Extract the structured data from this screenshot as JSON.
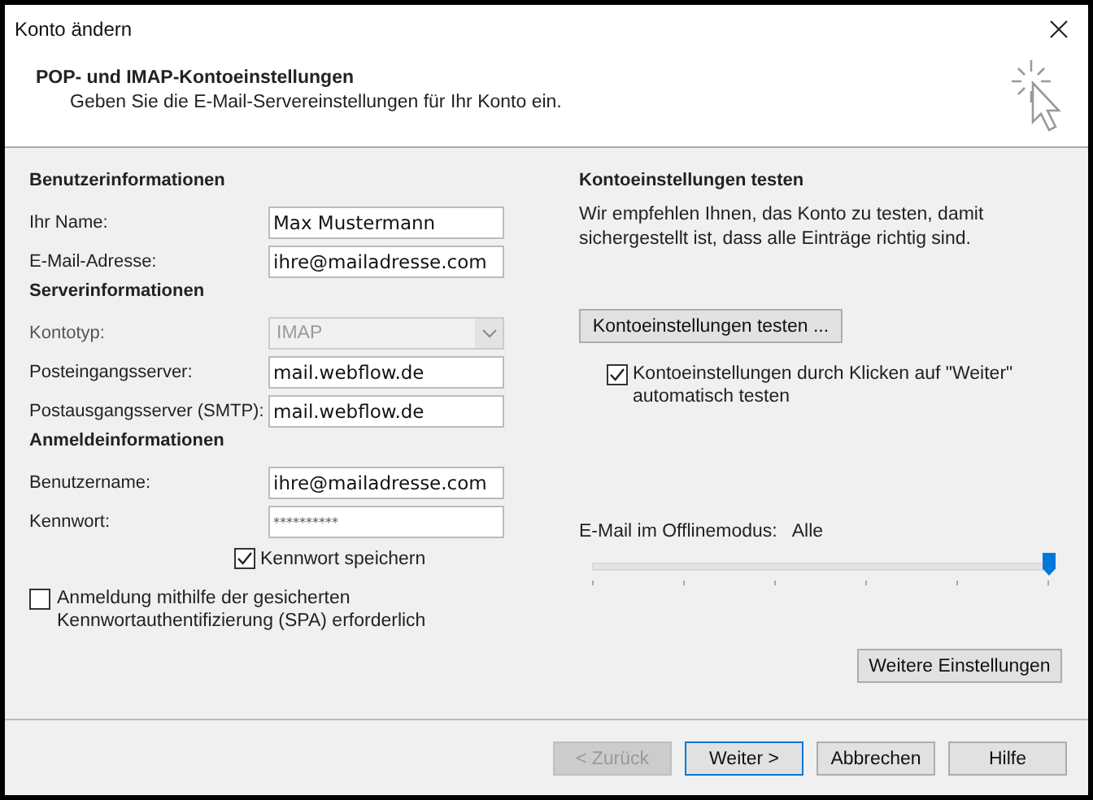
{
  "window": {
    "title": "Konto ändern"
  },
  "header": {
    "title": "POP- und IMAP-Kontoeinstellungen",
    "subtitle": "Geben Sie die E-Mail-Servereinstellungen für Ihr Konto ein."
  },
  "groups": [
    {
      "heading": "Benutzerinformationen",
      "fields": [
        {
          "label": "Ihr Name:",
          "value": "Max Mustermann",
          "kind": "text",
          "disabled": false
        },
        {
          "label": "E-Mail-Adresse:",
          "value": "ihre@mailadresse.com",
          "kind": "text",
          "disabled": false
        }
      ]
    },
    {
      "heading": "Serverinformationen",
      "fields": [
        {
          "label": "Kontotyp:",
          "value": "IMAP",
          "kind": "select",
          "disabled": true
        },
        {
          "label": "Posteingangsserver:",
          "value": "mail.webflow.de",
          "kind": "text",
          "disabled": false
        },
        {
          "label": "Postausgangsserver (SMTP):",
          "value": "mail.webflow.de",
          "kind": "text",
          "disabled": false
        }
      ]
    },
    {
      "heading": "Anmeldeinformationen",
      "fields": [
        {
          "label": "Benutzername:",
          "value": "ihre@mailadresse.com",
          "kind": "text",
          "disabled": false
        },
        {
          "label": "Kennwort:",
          "value": "**********",
          "kind": "password",
          "disabled": false
        }
      ]
    }
  ],
  "save_password": {
    "label": "Kennwort speichern",
    "checked": true
  },
  "spa": {
    "label": "Anmeldung mithilfe der gesicherten Kennwortauthentifizierung (SPA) erforderlich",
    "checked": false
  },
  "test": {
    "heading": "Kontoeinstellungen testen",
    "text": "Wir empfehlen Ihnen, das Konto zu testen, damit sichergestellt ist, dass alle Einträge richtig sind.",
    "button": "Kontoeinstellungen testen ...",
    "auto_test": {
      "label": "Kontoeinstellungen durch Klicken auf \"Weiter\" automatisch testen",
      "checked": true
    }
  },
  "offline": {
    "label": "E-Mail im Offlinemodus:",
    "value": "Alle",
    "level": 1
  },
  "more_button": "Weitere Einstellungen",
  "footer_buttons": [
    {
      "label": "< Zurück",
      "disabled": true,
      "default": false
    },
    {
      "label": "Weiter >",
      "disabled": false,
      "default": true
    },
    {
      "label": "Abbrechen",
      "disabled": false,
      "default": false
    },
    {
      "label": "Hilfe",
      "disabled": false,
      "default": false
    }
  ]
}
